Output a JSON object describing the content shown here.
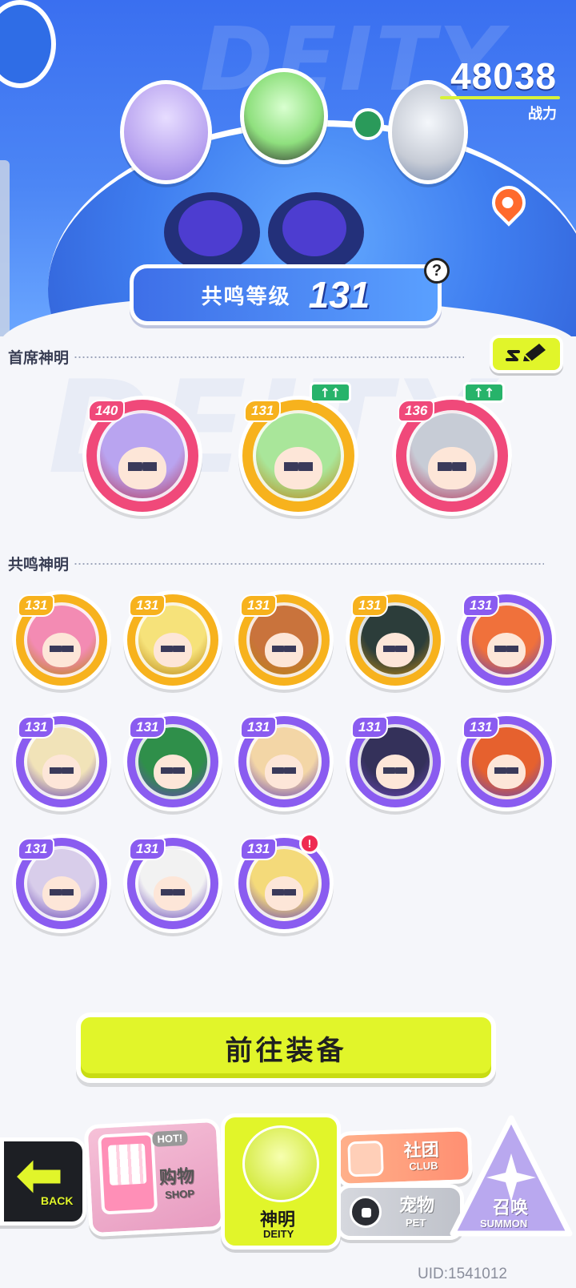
{
  "header": {
    "bg_word": "DEITY",
    "power_value": "48038",
    "power_label": "战力",
    "resonance_label": "共鸣等级",
    "resonance_level": "131",
    "help_symbol": "?"
  },
  "main_deities": {
    "title": "首席神明",
    "edit_icon": "pencil-icon",
    "items": [
      {
        "level": "140",
        "frame": "#f0497a",
        "face": "#b9a4f0",
        "upgrade": false
      },
      {
        "level": "131",
        "frame": "#f7b21d",
        "face": "#a9e69a",
        "upgrade": true
      },
      {
        "level": "136",
        "frame": "#f0497a",
        "face": "#c7ccd6",
        "upgrade": true
      }
    ]
  },
  "resonance_deities": {
    "title": "共鸣神明",
    "items": [
      {
        "level": "131",
        "frame": "#f7b21d",
        "face": "#f38bb3"
      },
      {
        "level": "131",
        "frame": "#f7b21d",
        "face": "#f6e27a"
      },
      {
        "level": "131",
        "frame": "#f7b21d",
        "face": "#c9733c"
      },
      {
        "level": "131",
        "frame": "#f7b21d",
        "face": "#2c3d3a"
      },
      {
        "level": "131",
        "frame": "#8a5cf0",
        "face": "#f0713b"
      },
      {
        "level": "131",
        "frame": "#8a5cf0",
        "face": "#f1e3b8"
      },
      {
        "level": "131",
        "frame": "#8a5cf0",
        "face": "#2f8f4a"
      },
      {
        "level": "131",
        "frame": "#8a5cf0",
        "face": "#f3d6a6"
      },
      {
        "level": "131",
        "frame": "#8a5cf0",
        "face": "#34315a"
      },
      {
        "level": "131",
        "frame": "#8a5cf0",
        "face": "#e6612e"
      },
      {
        "level": "131",
        "frame": "#8a5cf0",
        "face": "#d8cdea"
      },
      {
        "level": "131",
        "frame": "#8a5cf0",
        "face": "#f2f2f2"
      },
      {
        "level": "131",
        "frame": "#8a5cf0",
        "face": "#f4da7a",
        "alert": true
      }
    ]
  },
  "upgrade_symbol": "↑↑",
  "alert_symbol": "!",
  "equip_button": "前往装备",
  "bottom_nav": {
    "back_cn": "",
    "back_en": "BACK",
    "shop_cn": "购物",
    "shop_en": "SHOP",
    "shop_badge": "HOT!",
    "deity_cn": "神明",
    "deity_en": "DEITY",
    "club_cn": "社团",
    "club_en": "CLUB",
    "pet_cn": "宠物",
    "pet_en": "PET",
    "summon_cn": "召唤",
    "summon_en": "SUMMON"
  },
  "uid": "UID:1541012",
  "colors": {
    "accent_lime": "#e1f52a",
    "banner_blue": "#3a6ff0",
    "level_green": "#27b36a"
  }
}
